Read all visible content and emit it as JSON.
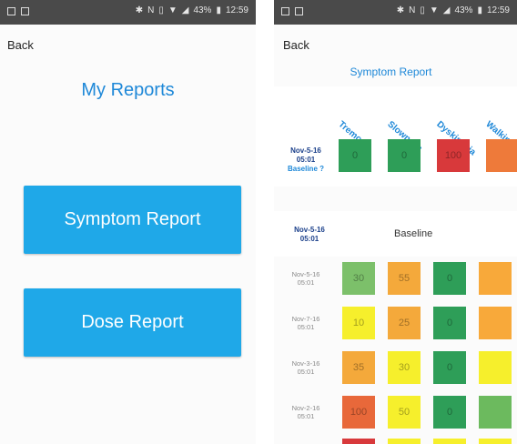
{
  "status_bar": {
    "time": "12:59",
    "battery": "43%"
  },
  "left": {
    "back_label": "Back",
    "title": "My Reports",
    "buttons": {
      "symptom": "Symptom Report",
      "dose": "Dose Report"
    }
  },
  "right": {
    "back_label": "Back",
    "title": "Symptom Report",
    "columns": [
      "Tremor",
      "Slowness",
      "Dyskinesia",
      "Walking"
    ],
    "baseline_row": {
      "date": "Nov-5-16",
      "time": "05:01",
      "label": "Baseline ?",
      "values": [
        "0",
        "0",
        "100",
        ""
      ]
    },
    "section": {
      "date": "Nov-5-16",
      "time": "05:01",
      "label": "Baseline"
    },
    "rows": [
      {
        "date": "Nov-5-16",
        "time": "05:01",
        "values": [
          "30",
          "55",
          "0",
          ""
        ]
      },
      {
        "date": "Nov-7-16",
        "time": "05:01",
        "values": [
          "10",
          "25",
          "0",
          ""
        ]
      },
      {
        "date": "Nov-3-16",
        "time": "05:01",
        "values": [
          "35",
          "30",
          "0",
          ""
        ]
      },
      {
        "date": "Nov-2-16",
        "time": "05:01",
        "values": [
          "100",
          "50",
          "0",
          ""
        ]
      }
    ],
    "colors": {
      "baseline": [
        "#2e9e58",
        "#2e9e58",
        "#d8393b",
        "#ee7a3a"
      ],
      "rows": [
        [
          "#7cc06a",
          "#f4a93b",
          "#2e9e58",
          "#f8a93a"
        ],
        [
          "#f6ef2c",
          "#f4a93b",
          "#2e9e58",
          "#f8a93a"
        ],
        [
          "#f4a93b",
          "#f6ef2c",
          "#2e9e58",
          "#f6ef2c"
        ],
        [
          "#e8683a",
          "#f6ef2c",
          "#2e9e58",
          "#6cba5e"
        ]
      ]
    }
  }
}
